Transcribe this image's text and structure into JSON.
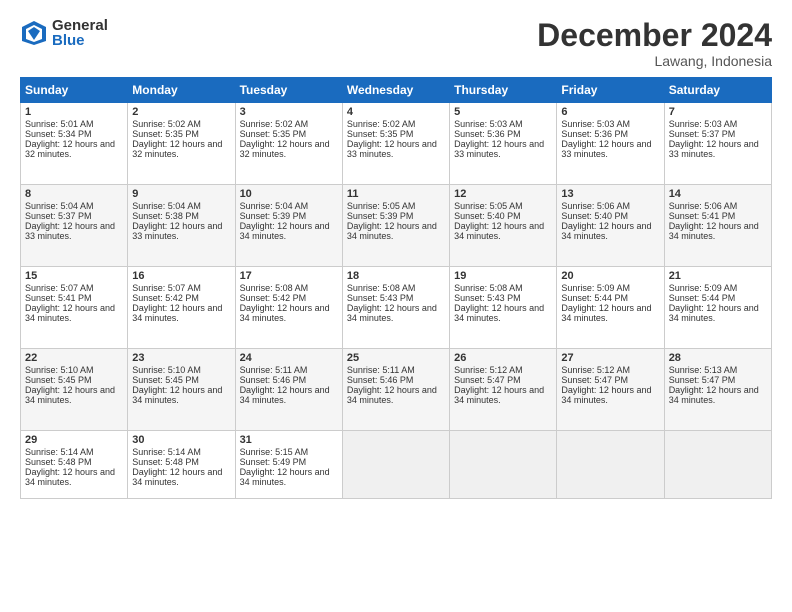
{
  "logo": {
    "general": "General",
    "blue": "Blue"
  },
  "title": "December 2024",
  "location": "Lawang, Indonesia",
  "days": [
    "Sunday",
    "Monday",
    "Tuesday",
    "Wednesday",
    "Thursday",
    "Friday",
    "Saturday"
  ],
  "weeks": [
    [
      {
        "num": "1",
        "sunrise": "Sunrise: 5:01 AM",
        "sunset": "Sunset: 5:34 PM",
        "daylight": "Daylight: 12 hours and 32 minutes."
      },
      {
        "num": "2",
        "sunrise": "Sunrise: 5:02 AM",
        "sunset": "Sunset: 5:35 PM",
        "daylight": "Daylight: 12 hours and 32 minutes."
      },
      {
        "num": "3",
        "sunrise": "Sunrise: 5:02 AM",
        "sunset": "Sunset: 5:35 PM",
        "daylight": "Daylight: 12 hours and 32 minutes."
      },
      {
        "num": "4",
        "sunrise": "Sunrise: 5:02 AM",
        "sunset": "Sunset: 5:35 PM",
        "daylight": "Daylight: 12 hours and 33 minutes."
      },
      {
        "num": "5",
        "sunrise": "Sunrise: 5:03 AM",
        "sunset": "Sunset: 5:36 PM",
        "daylight": "Daylight: 12 hours and 33 minutes."
      },
      {
        "num": "6",
        "sunrise": "Sunrise: 5:03 AM",
        "sunset": "Sunset: 5:36 PM",
        "daylight": "Daylight: 12 hours and 33 minutes."
      },
      {
        "num": "7",
        "sunrise": "Sunrise: 5:03 AM",
        "sunset": "Sunset: 5:37 PM",
        "daylight": "Daylight: 12 hours and 33 minutes."
      }
    ],
    [
      {
        "num": "8",
        "sunrise": "Sunrise: 5:04 AM",
        "sunset": "Sunset: 5:37 PM",
        "daylight": "Daylight: 12 hours and 33 minutes."
      },
      {
        "num": "9",
        "sunrise": "Sunrise: 5:04 AM",
        "sunset": "Sunset: 5:38 PM",
        "daylight": "Daylight: 12 hours and 33 minutes."
      },
      {
        "num": "10",
        "sunrise": "Sunrise: 5:04 AM",
        "sunset": "Sunset: 5:39 PM",
        "daylight": "Daylight: 12 hours and 34 minutes."
      },
      {
        "num": "11",
        "sunrise": "Sunrise: 5:05 AM",
        "sunset": "Sunset: 5:39 PM",
        "daylight": "Daylight: 12 hours and 34 minutes."
      },
      {
        "num": "12",
        "sunrise": "Sunrise: 5:05 AM",
        "sunset": "Sunset: 5:40 PM",
        "daylight": "Daylight: 12 hours and 34 minutes."
      },
      {
        "num": "13",
        "sunrise": "Sunrise: 5:06 AM",
        "sunset": "Sunset: 5:40 PM",
        "daylight": "Daylight: 12 hours and 34 minutes."
      },
      {
        "num": "14",
        "sunrise": "Sunrise: 5:06 AM",
        "sunset": "Sunset: 5:41 PM",
        "daylight": "Daylight: 12 hours and 34 minutes."
      }
    ],
    [
      {
        "num": "15",
        "sunrise": "Sunrise: 5:07 AM",
        "sunset": "Sunset: 5:41 PM",
        "daylight": "Daylight: 12 hours and 34 minutes."
      },
      {
        "num": "16",
        "sunrise": "Sunrise: 5:07 AM",
        "sunset": "Sunset: 5:42 PM",
        "daylight": "Daylight: 12 hours and 34 minutes."
      },
      {
        "num": "17",
        "sunrise": "Sunrise: 5:08 AM",
        "sunset": "Sunset: 5:42 PM",
        "daylight": "Daylight: 12 hours and 34 minutes."
      },
      {
        "num": "18",
        "sunrise": "Sunrise: 5:08 AM",
        "sunset": "Sunset: 5:43 PM",
        "daylight": "Daylight: 12 hours and 34 minutes."
      },
      {
        "num": "19",
        "sunrise": "Sunrise: 5:08 AM",
        "sunset": "Sunset: 5:43 PM",
        "daylight": "Daylight: 12 hours and 34 minutes."
      },
      {
        "num": "20",
        "sunrise": "Sunrise: 5:09 AM",
        "sunset": "Sunset: 5:44 PM",
        "daylight": "Daylight: 12 hours and 34 minutes."
      },
      {
        "num": "21",
        "sunrise": "Sunrise: 5:09 AM",
        "sunset": "Sunset: 5:44 PM",
        "daylight": "Daylight: 12 hours and 34 minutes."
      }
    ],
    [
      {
        "num": "22",
        "sunrise": "Sunrise: 5:10 AM",
        "sunset": "Sunset: 5:45 PM",
        "daylight": "Daylight: 12 hours and 34 minutes."
      },
      {
        "num": "23",
        "sunrise": "Sunrise: 5:10 AM",
        "sunset": "Sunset: 5:45 PM",
        "daylight": "Daylight: 12 hours and 34 minutes."
      },
      {
        "num": "24",
        "sunrise": "Sunrise: 5:11 AM",
        "sunset": "Sunset: 5:46 PM",
        "daylight": "Daylight: 12 hours and 34 minutes."
      },
      {
        "num": "25",
        "sunrise": "Sunrise: 5:11 AM",
        "sunset": "Sunset: 5:46 PM",
        "daylight": "Daylight: 12 hours and 34 minutes."
      },
      {
        "num": "26",
        "sunrise": "Sunrise: 5:12 AM",
        "sunset": "Sunset: 5:47 PM",
        "daylight": "Daylight: 12 hours and 34 minutes."
      },
      {
        "num": "27",
        "sunrise": "Sunrise: 5:12 AM",
        "sunset": "Sunset: 5:47 PM",
        "daylight": "Daylight: 12 hours and 34 minutes."
      },
      {
        "num": "28",
        "sunrise": "Sunrise: 5:13 AM",
        "sunset": "Sunset: 5:47 PM",
        "daylight": "Daylight: 12 hours and 34 minutes."
      }
    ],
    [
      {
        "num": "29",
        "sunrise": "Sunrise: 5:14 AM",
        "sunset": "Sunset: 5:48 PM",
        "daylight": "Daylight: 12 hours and 34 minutes."
      },
      {
        "num": "30",
        "sunrise": "Sunrise: 5:14 AM",
        "sunset": "Sunset: 5:48 PM",
        "daylight": "Daylight: 12 hours and 34 minutes."
      },
      {
        "num": "31",
        "sunrise": "Sunrise: 5:15 AM",
        "sunset": "Sunset: 5:49 PM",
        "daylight": "Daylight: 12 hours and 34 minutes."
      },
      null,
      null,
      null,
      null
    ]
  ]
}
